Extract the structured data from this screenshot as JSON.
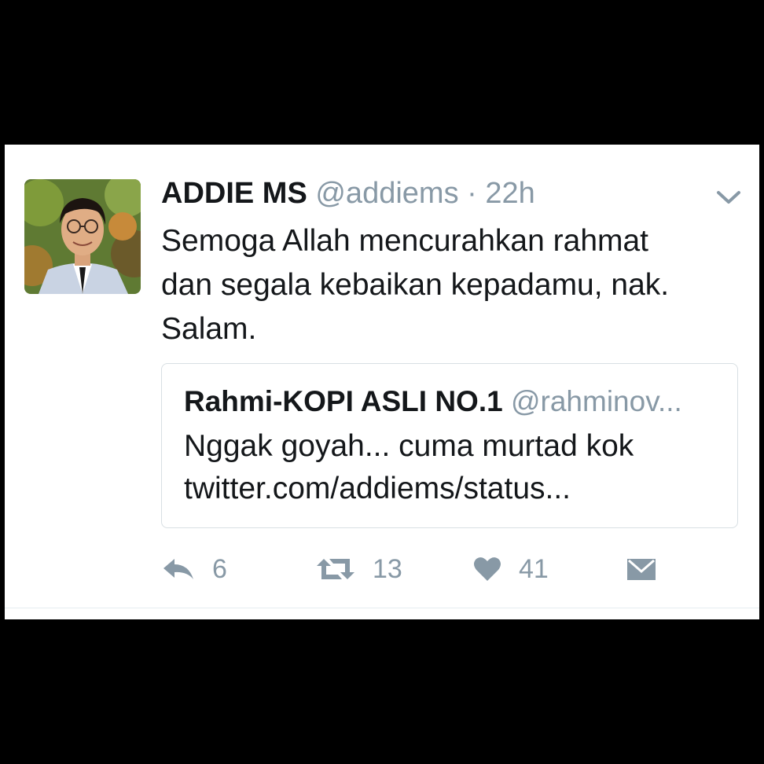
{
  "tweet": {
    "author_name": "ADDIE MS",
    "author_handle": "@addiems",
    "separator": "·",
    "time": "22h",
    "text_lines": [
      "Semoga Allah mencurahkan rahmat",
      "dan segala kebaikan kepadamu, nak.",
      "Salam."
    ]
  },
  "quoted_tweet": {
    "author_name": "Rahmi-KOPI ASLI NO.1",
    "author_handle": "@rahminov...",
    "text_lines": [
      "Nggak goyah... cuma murtad kok",
      "twitter.com/addiems/status..."
    ]
  },
  "actions": {
    "reply_count": "6",
    "retweet_count": "13",
    "like_count": "41"
  },
  "icons": {
    "menu": "chevron-down-icon",
    "reply": "reply-icon",
    "retweet": "retweet-icon",
    "like": "heart-icon",
    "dm": "envelope-icon"
  },
  "colors": {
    "background": "#000000",
    "card": "#ffffff",
    "text": "#14171a",
    "muted": "#8899a6",
    "border": "#d8dfe3"
  }
}
